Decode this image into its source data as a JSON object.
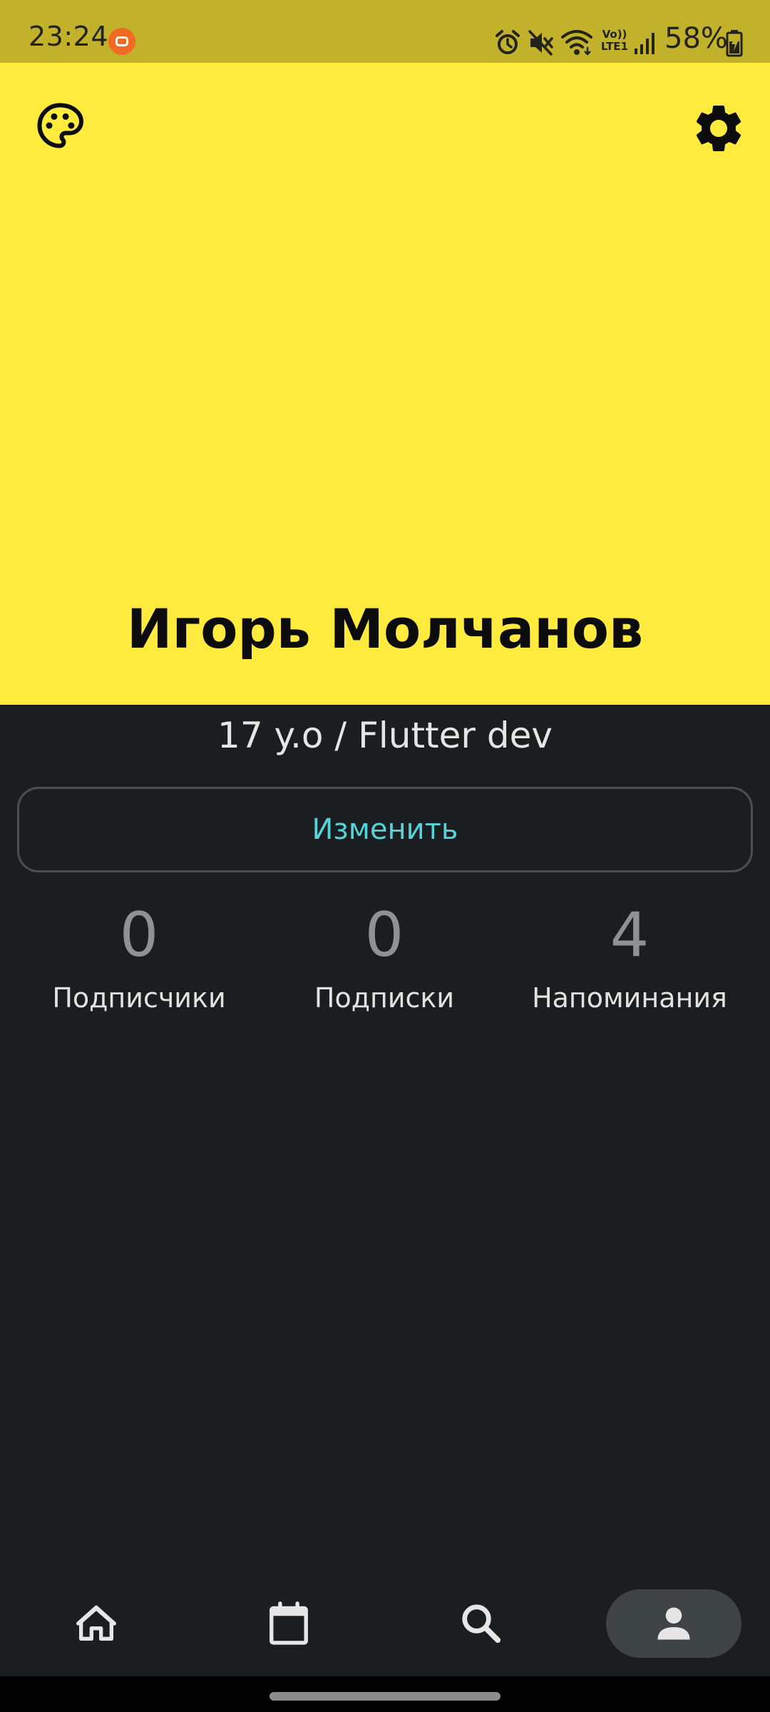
{
  "status_bar": {
    "time": "23:24",
    "battery_percent": "58%",
    "network_label": "Vo)) LTE1",
    "icons": [
      "app-notification-icon",
      "alarm-icon",
      "mute-icon",
      "wifi-icon",
      "signal-icon",
      "battery-icon"
    ]
  },
  "header": {
    "background_color": "#ffea3e",
    "name": "Игорь Молчанов",
    "icons": [
      "palette-icon",
      "settings-icon"
    ]
  },
  "profile": {
    "subtitle": "17 y.o / Flutter dev",
    "edit_label": "Изменить"
  },
  "stats": [
    {
      "value": "0",
      "label": "Подписчики"
    },
    {
      "value": "0",
      "label": "Подписки"
    },
    {
      "value": "4",
      "label": "Напоминания"
    }
  ],
  "bottom_nav": {
    "items": [
      {
        "icon": "home-icon",
        "active": false
      },
      {
        "icon": "calendar-icon",
        "active": false
      },
      {
        "icon": "search-icon",
        "active": false
      },
      {
        "icon": "person-icon",
        "active": true
      }
    ]
  },
  "colors": {
    "accent": "#56d3d8",
    "background": "#1b1e20",
    "status_bar": "#c1b12b"
  }
}
